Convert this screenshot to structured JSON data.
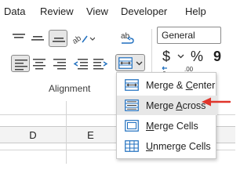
{
  "tabs": [
    "Data",
    "Review",
    "View",
    "Developer",
    "Help"
  ],
  "ribbon": {
    "group_label": "Alignment",
    "number_format": "General",
    "currency_symbol": "$",
    "percent_symbol": "%",
    "comma_symbol": "9"
  },
  "columns": [
    "D",
    "E"
  ],
  "merge_menu": {
    "items": [
      {
        "pre": "Merge & ",
        "key": "C",
        "post": "enter"
      },
      {
        "pre": "Merge ",
        "key": "A",
        "post": "cross"
      },
      {
        "pre": "",
        "key": "M",
        "post": "erge Cells"
      },
      {
        "pre": "",
        "key": "U",
        "post": "nmerge Cells"
      }
    ],
    "highlighted_index": 1
  },
  "colors": {
    "accent_blue": "#1f6fbf",
    "arrow_red": "#e0352b",
    "highlight": "#e7e7e7"
  }
}
